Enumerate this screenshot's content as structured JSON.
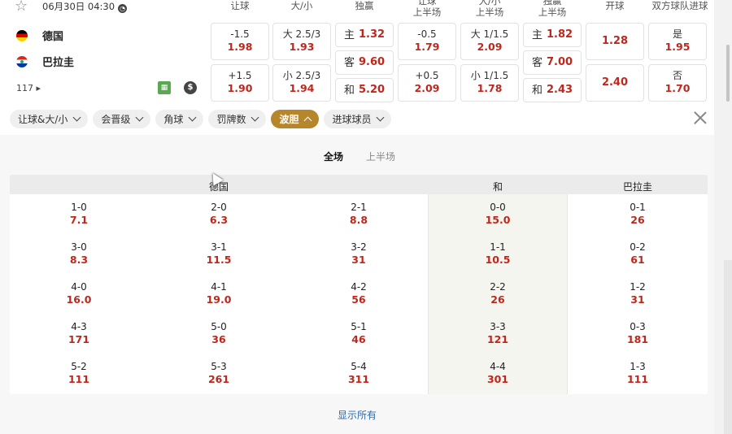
{
  "match": {
    "date": "06月30日 04:30",
    "home": "德国",
    "away": "巴拉圭",
    "more_count": "117"
  },
  "columns": [
    "让球",
    "大/小",
    "独赢",
    "让球\n上半场",
    "大/小\n上半场",
    "独赢\n上半场",
    "开球",
    "双方球队进球"
  ],
  "odds": {
    "hcap": [
      {
        "l": "-1.5",
        "v": "1.98"
      },
      {
        "l": "+1.5",
        "v": "1.90"
      }
    ],
    "ou": [
      {
        "l": "大 2.5/3",
        "v": "1.93"
      },
      {
        "l": "小 2.5/3",
        "v": "1.94"
      }
    ],
    "win": [
      {
        "l": "主",
        "v": "1.32"
      },
      {
        "l": "客",
        "v": "9.60"
      },
      {
        "l": "和",
        "v": "5.20"
      }
    ],
    "hcap_h1": [
      {
        "l": "-0.5",
        "v": "1.79"
      },
      {
        "l": "+0.5",
        "v": "2.09"
      }
    ],
    "ou_h1": [
      {
        "l": "大 1/1.5",
        "v": "2.09"
      },
      {
        "l": "小 1/1.5",
        "v": "1.78"
      }
    ],
    "win_h1": [
      {
        "l": "主",
        "v": "1.82"
      },
      {
        "l": "客",
        "v": "7.00"
      },
      {
        "l": "和",
        "v": "2.43"
      }
    ],
    "kickoff": [
      {
        "v": "1.28"
      },
      {
        "v": "2.40"
      }
    ],
    "btts": [
      {
        "l": "是",
        "v": "1.95"
      },
      {
        "l": "否",
        "v": "1.70"
      }
    ]
  },
  "filters": [
    "让球&大/小",
    "会晋级",
    "角球",
    "罚牌数",
    "波胆",
    "进球球员"
  ],
  "active_filter": "波胆",
  "tabs": [
    "全场",
    "上半场"
  ],
  "grid_headers": {
    "home": "德国",
    "draw": "和",
    "away": "巴拉圭"
  },
  "scores": [
    [
      {
        "s": "1-0",
        "o": "7.1"
      },
      {
        "s": "2-0",
        "o": "6.3"
      },
      {
        "s": "2-1",
        "o": "8.8"
      },
      {
        "s": "0-0",
        "o": "15.0"
      },
      {
        "s": "0-1",
        "o": "26"
      }
    ],
    [
      {
        "s": "3-0",
        "o": "8.3"
      },
      {
        "s": "3-1",
        "o": "11.5"
      },
      {
        "s": "3-2",
        "o": "31"
      },
      {
        "s": "1-1",
        "o": "10.5"
      },
      {
        "s": "0-2",
        "o": "61"
      }
    ],
    [
      {
        "s": "4-0",
        "o": "16.0"
      },
      {
        "s": "4-1",
        "o": "19.0"
      },
      {
        "s": "4-2",
        "o": "56"
      },
      {
        "s": "2-2",
        "o": "26"
      },
      {
        "s": "1-2",
        "o": "31"
      }
    ],
    [
      {
        "s": "4-3",
        "o": "171"
      },
      {
        "s": "5-0",
        "o": "36"
      },
      {
        "s": "5-1",
        "o": "46"
      },
      {
        "s": "3-3",
        "o": "121"
      },
      {
        "s": "0-3",
        "o": "181"
      }
    ],
    [
      {
        "s": "5-2",
        "o": "111"
      },
      {
        "s": "5-3",
        "o": "261"
      },
      {
        "s": "5-4",
        "o": "311"
      },
      {
        "s": "4-4",
        "o": "301"
      },
      {
        "s": "1-3",
        "o": "111"
      }
    ]
  ],
  "show_all": "显示所有",
  "colors": {
    "odds": "#c0271c",
    "active_chip": "#b8862a",
    "link": "#2b6cb0"
  }
}
